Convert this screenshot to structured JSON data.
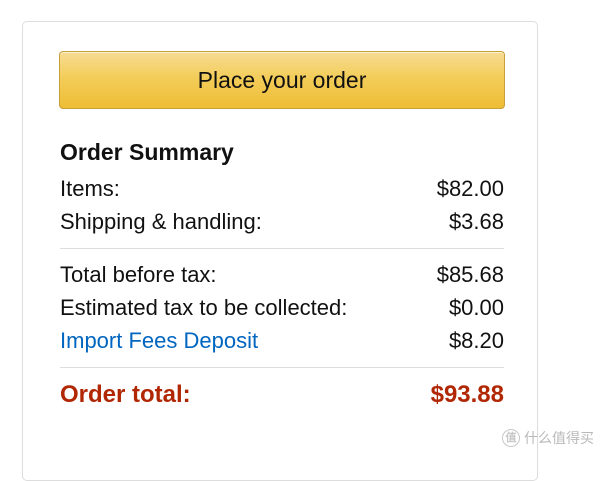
{
  "colors": {
    "button_gradient_top": "#f7dc93",
    "button_gradient_bottom": "#eebd35",
    "link": "#0066c0",
    "order_total": "#b12704",
    "divider": "#dddddd"
  },
  "button": {
    "label": "Place your order"
  },
  "summary": {
    "title": "Order Summary",
    "items": {
      "label": "Items:",
      "value": "$82.00"
    },
    "shipping": {
      "label": "Shipping & handling:",
      "value": "$3.68"
    },
    "total_before_tax": {
      "label": "Total before tax:",
      "value": "$85.68"
    },
    "estimated_tax": {
      "label": "Estimated tax to be collected:",
      "value": "$0.00"
    },
    "import_fees": {
      "label": "Import Fees Deposit",
      "value": "$8.20"
    },
    "order_total": {
      "label": "Order total:",
      "value": "$93.88"
    }
  },
  "watermark": {
    "badge": "值",
    "text": "什么值得买"
  }
}
